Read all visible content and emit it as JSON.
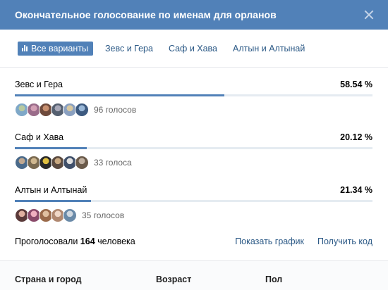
{
  "header": {
    "title": "Окончательное голосование по именам для орланов"
  },
  "tabs": [
    {
      "label": "Все варианты"
    },
    {
      "label": "Зевс и Гера"
    },
    {
      "label": "Саф и Хава"
    },
    {
      "label": "Алтын и Алтынай"
    }
  ],
  "options": [
    {
      "name": "Зевс и Гера",
      "percent_label": "58.54 %",
      "percent": 0.5854,
      "votes": "96 голосов",
      "avatar_colors": [
        [
          "#7fa8c8",
          "#b8c9a0"
        ],
        [
          "#9a6c8a",
          "#d3a0b5"
        ],
        [
          "#6e4a3c",
          "#c89070"
        ],
        [
          "#556070",
          "#a8a8b8"
        ],
        [
          "#8aa0c0",
          "#d8c8a0"
        ],
        [
          "#3d5a80",
          "#9ab8d8"
        ]
      ]
    },
    {
      "name": "Саф и Хава",
      "percent_label": "20.12 %",
      "percent": 0.2012,
      "votes": "33 голоса",
      "avatar_colors": [
        [
          "#4a6a8a",
          "#c0a890"
        ],
        [
          "#7a6a50",
          "#d0b890"
        ],
        [
          "#2a2a2a",
          "#e0c040"
        ],
        [
          "#5a4a40",
          "#c8a880"
        ],
        [
          "#40506a",
          "#e0e0e0"
        ],
        [
          "#6a5a4a",
          "#c0b0a0"
        ]
      ]
    },
    {
      "name": "Алтын и Алтынай",
      "percent_label": "21.34 %",
      "percent": 0.2134,
      "votes": "35 голосов",
      "avatar_colors": [
        [
          "#5a3a3a",
          "#e0b0a0"
        ],
        [
          "#8a4a6a",
          "#f0b0c0"
        ],
        [
          "#9a6a4a",
          "#e0c0a0"
        ],
        [
          "#b08870",
          "#f0d8c8"
        ],
        [
          "#6a8aa8",
          "#d0d8e0"
        ]
      ]
    }
  ],
  "footer": {
    "total_prefix": "Проголосовали",
    "total_count": "164",
    "total_suffix": "человека",
    "show_chart": "Показать график",
    "get_code": "Получить код"
  },
  "filters": {
    "country_city": "Страна и город",
    "age": "Возраст",
    "gender": "Пол"
  },
  "colors": {
    "accent": "#5181b8",
    "link": "#2a5885"
  }
}
